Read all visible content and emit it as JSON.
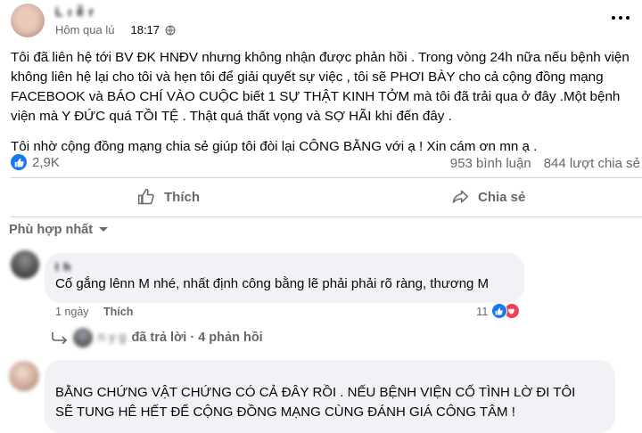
{
  "post": {
    "author_name": "L ı ễ r",
    "time_label": "Hôm qua lú",
    "time": "18:17",
    "globe_icon": "globe-icon",
    "paragraph_1": "Tôi đã liên hệ tới BV ĐK HNĐV nhưng không nhận được phản hồi . Trong vòng 24h nữa nếu bệnh viện không liên hệ lại cho tôi và hẹn tôi để giải quyết sự việc , tôi sẽ PHƠI BÀY cho cả cộng đồng mạng FACEBOOK và BÁO CHÍ VÀO CUỘC  biết 1 SỰ THẬT KINH TỞM mà tôi đã trải qua ở đây .Một bệnh viện mà Y ĐỨC quá TỒI TỆ .  Thật quá thất vọng và SỢ HÃI khi đến đây .",
    "paragraph_2": "Tôi nhờ cộng đồng mạng chia sẻ giúp tôi đòi lại CÔNG BẰNG với ạ ! Xin cám ơn mn ạ ."
  },
  "stats": {
    "reactions": "2,9K",
    "comments": "953 bình luận",
    "shares": "844 lượt chia sẻ"
  },
  "actions": {
    "like": "Thích",
    "share": "Chia sẻ"
  },
  "sort_label": "Phù hợp nhất",
  "comments": [
    {
      "name": "I   h  ",
      "text": "Cố gắng lênn M nhé, nhất định công bằng lẽ phải phải rõ ràng, thương M",
      "time": "1 ngày",
      "like_label": "Thích",
      "reaction_count": "11"
    },
    {
      "name": "  ",
      "text": "BẰNG CHỨNG VẬT CHỨNG CÓ CẢ ĐÂY RỒI . NẾU BỆNH VIỆN CỐ TÌNH LỜ ĐI TÔI SẼ TUNG HÊ HẾT ĐỂ CỘNG ĐỒNG MẠNG CÙNG ĐÁNH GIÁ CÔNG TÂM !"
    }
  ],
  "replies": {
    "names": "n    y   g  ",
    "action": "đã trả lời · 4 phản hồi"
  },
  "colors": {
    "facebook_blue": "#1877f2",
    "love_red": "#f33e58",
    "secondary_text": "#65676b",
    "bubble_bg": "#f0f2f5"
  }
}
